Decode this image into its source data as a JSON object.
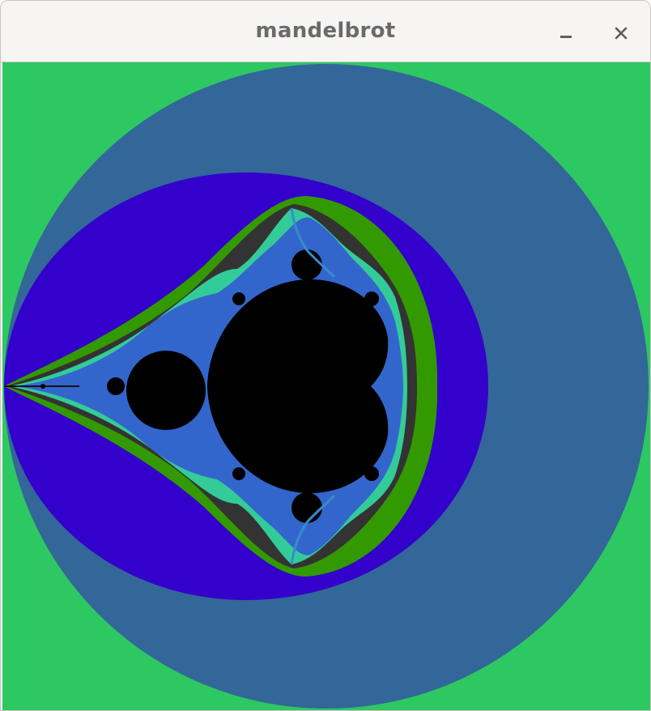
{
  "window": {
    "title": "mandelbrot",
    "minimize_label": "Minimize",
    "close_label": "Close"
  },
  "colors": {
    "band_outer": "#2ec862",
    "band_2": "#336699",
    "band_3": "#3300cc",
    "band_4": "#339900",
    "band_5": "#333333",
    "band_6": "#33cc99",
    "band_7": "#3366cc",
    "set_interior": "#000000"
  },
  "icons": {
    "minimize": "minimize-icon",
    "close": "close-icon"
  }
}
